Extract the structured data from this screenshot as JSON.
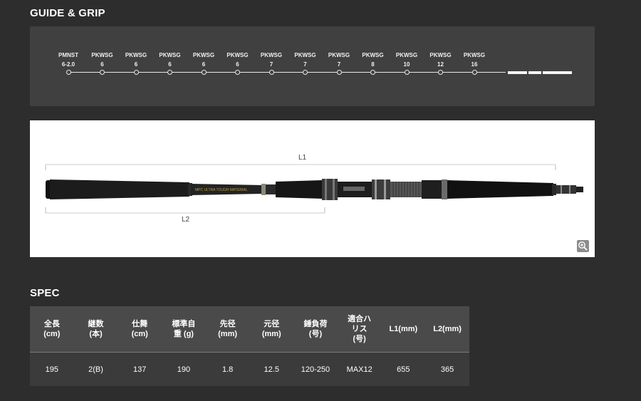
{
  "guide_section": {
    "title": "GUIDE & GRIP",
    "guides": [
      {
        "name": "PMNST",
        "size": "6-2.0"
      },
      {
        "name": "PKWSG",
        "size": "6"
      },
      {
        "name": "PKWSG",
        "size": "6"
      },
      {
        "name": "PKWSG",
        "size": "6"
      },
      {
        "name": "PKWSG",
        "size": "6"
      },
      {
        "name": "PKWSG",
        "size": "6"
      },
      {
        "name": "PKWSG",
        "size": "7"
      },
      {
        "name": "PKWSG",
        "size": "7"
      },
      {
        "name": "PKWSG",
        "size": "7"
      },
      {
        "name": "PKWSG",
        "size": "8"
      },
      {
        "name": "PKWSG",
        "size": "10"
      },
      {
        "name": "PKWSG",
        "size": "12"
      },
      {
        "name": "PKWSG",
        "size": "16"
      }
    ]
  },
  "rod_image": {
    "dimension_l1": "L1",
    "dimension_l2": "L2",
    "blank_print": "MPC ULTRA TOUGH MATERIAL",
    "zoom_icon": "magnifier-plus-icon"
  },
  "spec_section": {
    "title": "SPEC",
    "headers": [
      "全長\n(cm)",
      "継数\n(本)",
      "仕舞\n(cm)",
      "標準自\n重 (g)",
      "先径\n(mm)",
      "元径\n(mm)",
      "錘負荷\n(号)",
      "適合ハ\nリス\n(号)",
      "L1(mm)",
      "L2(mm)"
    ],
    "values": [
      "195",
      "2(B)",
      "137",
      "190",
      "1.8",
      "12.5",
      "120-250",
      "MAX12",
      "655",
      "365"
    ]
  }
}
